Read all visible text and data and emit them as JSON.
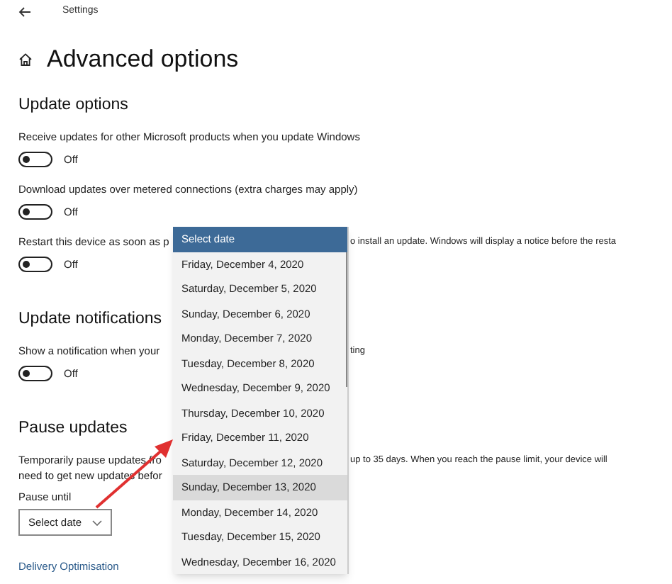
{
  "window": {
    "title": "Settings"
  },
  "page_title": "Advanced options",
  "sections": [
    {
      "heading": "Update options",
      "items": [
        {
          "kind": "toggle",
          "label": "Receive updates for other Microsoft products when you update Windows",
          "on": false,
          "state_label": "Off"
        },
        {
          "kind": "toggle",
          "label": "Download updates over metered connections (extra charges may apply)",
          "on": false,
          "state_label": "Off"
        },
        {
          "kind": "toggle",
          "label": "Restart this device as soon as p",
          "label_right": "o install an update. Windows will display a notice before the resta",
          "on": false,
          "state_label": "Off"
        }
      ]
    },
    {
      "heading": "Update notifications",
      "items": [
        {
          "kind": "toggle",
          "label": "Show a notification when your",
          "label_right": "ting",
          "on": false,
          "state_label": "Off"
        }
      ]
    },
    {
      "heading": "Pause updates",
      "items": [
        {
          "kind": "text",
          "lines": [
            "Temporarily pause updates fro",
            "need to get new updates befor"
          ],
          "label_right": "up to 35 days. When you reach the pause limit, your device will"
        },
        {
          "kind": "select",
          "label": "Pause until",
          "value": "Select date",
          "dropdown": {
            "options": [
              {
                "label": "Select date",
                "selected": true,
                "highlighted": false
              },
              {
                "label": "Friday, December 4, 2020",
                "selected": false,
                "highlighted": false
              },
              {
                "label": "Saturday, December 5, 2020",
                "selected": false,
                "highlighted": false
              },
              {
                "label": "Sunday, December 6, 2020",
                "selected": false,
                "highlighted": false
              },
              {
                "label": "Monday, December 7, 2020",
                "selected": false,
                "highlighted": false
              },
              {
                "label": "Tuesday, December 8, 2020",
                "selected": false,
                "highlighted": false
              },
              {
                "label": "Wednesday, December 9, 2020",
                "selected": false,
                "highlighted": false
              },
              {
                "label": "Thursday, December 10, 2020",
                "selected": false,
                "highlighted": false
              },
              {
                "label": "Friday, December 11, 2020",
                "selected": false,
                "highlighted": false
              },
              {
                "label": "Saturday, December 12, 2020",
                "selected": false,
                "highlighted": false
              },
              {
                "label": "Sunday, December 13, 2020",
                "selected": false,
                "highlighted": true
              },
              {
                "label": "Monday, December 14, 2020",
                "selected": false,
                "highlighted": false
              },
              {
                "label": "Tuesday, December 15, 2020",
                "selected": false,
                "highlighted": false
              },
              {
                "label": "Wednesday, December 16, 2020",
                "selected": false,
                "highlighted": false
              }
            ]
          }
        },
        {
          "kind": "link",
          "label": "Delivery Optimisation"
        }
      ]
    }
  ]
}
